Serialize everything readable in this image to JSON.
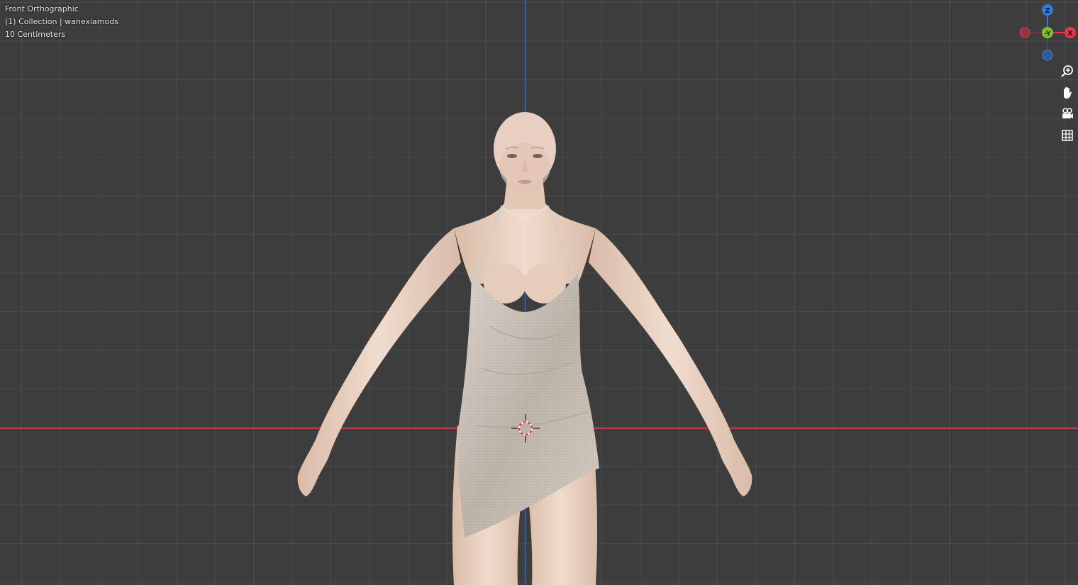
{
  "viewport": {
    "view_name": "Front Orthographic",
    "collection_info": "(1) Collection | wanexiamods",
    "scale_info": "10 Centimeters"
  },
  "gizmo": {
    "z_label": "Z",
    "y_label": "-Y",
    "x_label": "X",
    "colors": {
      "z": "#2f7de0",
      "y": "#7fbf2a",
      "x": "#e0384c"
    }
  },
  "nav_buttons": [
    {
      "icon": "zoom-icon"
    },
    {
      "icon": "hand-pan-icon"
    },
    {
      "icon": "camera-icon"
    },
    {
      "icon": "grid-icon"
    }
  ],
  "colors": {
    "background": "#3d3d3d",
    "grid": "#4a4a4a",
    "axis_red": "#b5404c",
    "axis_blue": "#3f74b8",
    "skin": "#e9d2c2",
    "dress": "#c9c0b6"
  }
}
